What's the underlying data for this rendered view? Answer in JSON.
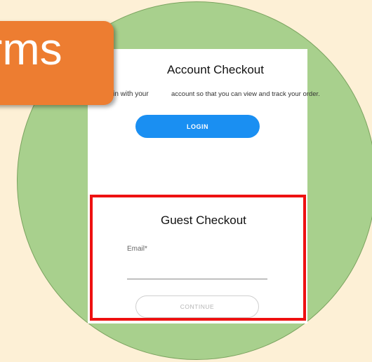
{
  "banner": {
    "text": "rms"
  },
  "account_checkout": {
    "title": "Account Checkout",
    "description_left": "ogin with your",
    "description_right": "account so that you can view and track your order.",
    "login_label": "LOGIN"
  },
  "guest_checkout": {
    "title": "Guest Checkout",
    "email_label": "Email*",
    "email_value": "",
    "continue_label": "CONTINUE"
  },
  "colors": {
    "background": "#fdf0d6",
    "circle": "#a8d08d",
    "banner": "#ed7d31",
    "login_button": "#1a8ff2",
    "highlight_border": "#ee1111"
  }
}
